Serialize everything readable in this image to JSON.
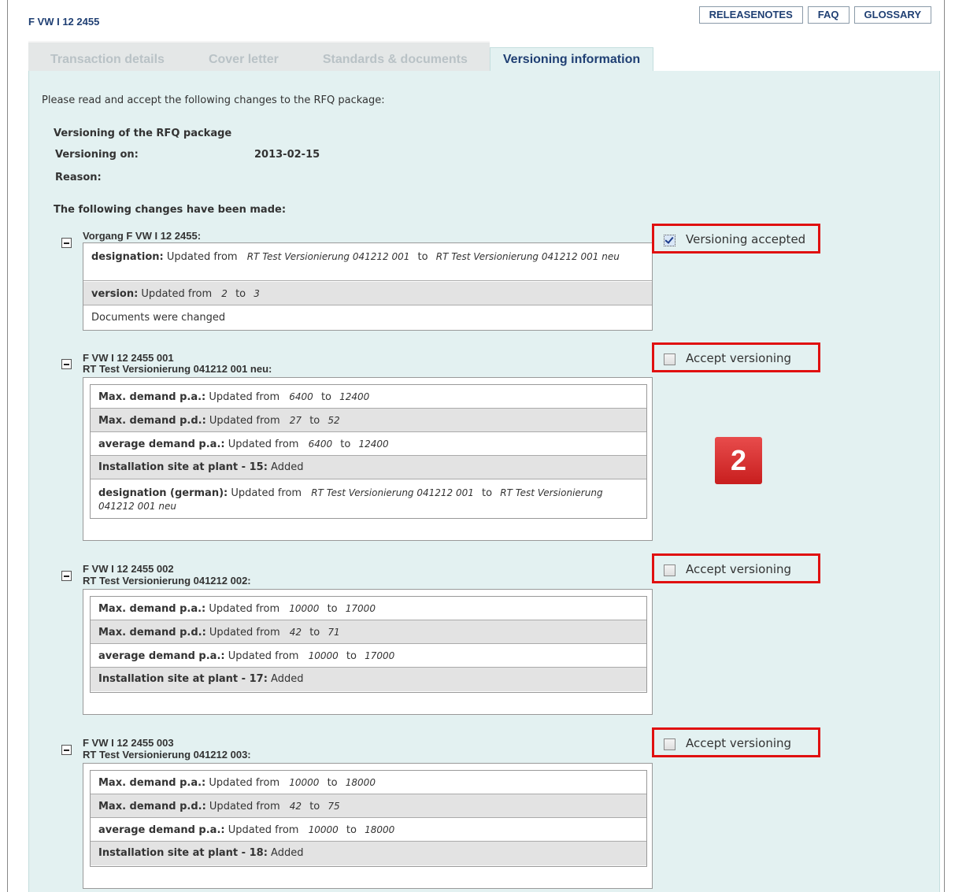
{
  "header": {
    "transaction_id": "F VW I 12 2455",
    "buttons": [
      "RELEASENOTES",
      "FAQ",
      "GLOSSARY"
    ]
  },
  "tabs": [
    {
      "label": "Transaction details",
      "active": false
    },
    {
      "label": "Cover letter",
      "active": false
    },
    {
      "label": "Standards & documents",
      "active": false
    },
    {
      "label": "Versioning information",
      "active": true
    }
  ],
  "intro": "Please read and accept the following changes to the RFQ package:",
  "versioning": {
    "heading": "Versioning of the RFQ package",
    "on_label": "Versioning on:",
    "on_value": "2013-02-15",
    "reason_label": "Reason:",
    "reason_value": "",
    "changes_heading": "The following changes have been made:"
  },
  "groups": [
    {
      "title_line1": "Vorgang F VW I 12 2455:",
      "title_line2": "",
      "accept_label": "Versioning accepted",
      "accepted": true,
      "rows": [
        {
          "key": "designation:",
          "text": "Updated from",
          "from": "RT Test Versionierung 041212 001",
          "to_word": "to",
          "to": "RT Test Versionierung 041212 001 neu"
        },
        {
          "key": "version:",
          "text": "Updated from",
          "from": "2",
          "to_word": "to",
          "to": "3"
        },
        {
          "key": "",
          "text": "Documents were changed",
          "from": "",
          "to_word": "",
          "to": ""
        }
      ]
    },
    {
      "title_line1": "F VW I 12 2455 001",
      "title_line2": "RT Test Versionierung 041212 001 neu:",
      "accept_label": "Accept versioning",
      "accepted": false,
      "rows": [
        {
          "key": "Max. demand p.a.:",
          "text": "Updated from",
          "from": "6400",
          "to_word": "to",
          "to": "12400"
        },
        {
          "key": "Max. demand p.d.:",
          "text": "Updated from",
          "from": "27",
          "to_word": "to",
          "to": "52"
        },
        {
          "key": "average demand p.a.:",
          "text": "Updated from",
          "from": "6400",
          "to_word": "to",
          "to": "12400"
        },
        {
          "key": "Installation site at plant - 15:",
          "text": "Added",
          "from": "",
          "to_word": "",
          "to": ""
        },
        {
          "key": "designation (german):",
          "text": "Updated from",
          "from": "RT Test Versionierung 041212 001",
          "to_word": "to",
          "to": "RT Test Versionierung 041212 001 neu"
        }
      ]
    },
    {
      "title_line1": "F VW I 12 2455 002",
      "title_line2": "RT Test Versionierung 041212 002:",
      "accept_label": "Accept versioning",
      "accepted": false,
      "rows": [
        {
          "key": "Max. demand p.a.:",
          "text": "Updated from",
          "from": "10000",
          "to_word": "to",
          "to": "17000"
        },
        {
          "key": "Max. demand p.d.:",
          "text": "Updated from",
          "from": "42",
          "to_word": "to",
          "to": "71"
        },
        {
          "key": "average demand p.a.:",
          "text": "Updated from",
          "from": "10000",
          "to_word": "to",
          "to": "17000"
        },
        {
          "key": "Installation site at plant - 17:",
          "text": "Added",
          "from": "",
          "to_word": "",
          "to": ""
        }
      ]
    },
    {
      "title_line1": "F VW I 12 2455 003",
      "title_line2": "RT Test Versionierung 041212 003:",
      "accept_label": "Accept versioning",
      "accepted": false,
      "rows": [
        {
          "key": "Max. demand p.a.:",
          "text": "Updated from",
          "from": "10000",
          "to_word": "to",
          "to": "18000"
        },
        {
          "key": "Max. demand p.d.:",
          "text": "Updated from",
          "from": "42",
          "to_word": "to",
          "to": "75"
        },
        {
          "key": "average demand p.a.:",
          "text": "Updated from",
          "from": "10000",
          "to_word": "to",
          "to": "18000"
        },
        {
          "key": "Installation site at plant - 18:",
          "text": "Added",
          "from": "",
          "to_word": "",
          "to": ""
        }
      ]
    }
  ],
  "badge": "2",
  "colors": {
    "highlight": "#e01010",
    "panel": "#e3f1f1",
    "title": "#1f3f73"
  }
}
